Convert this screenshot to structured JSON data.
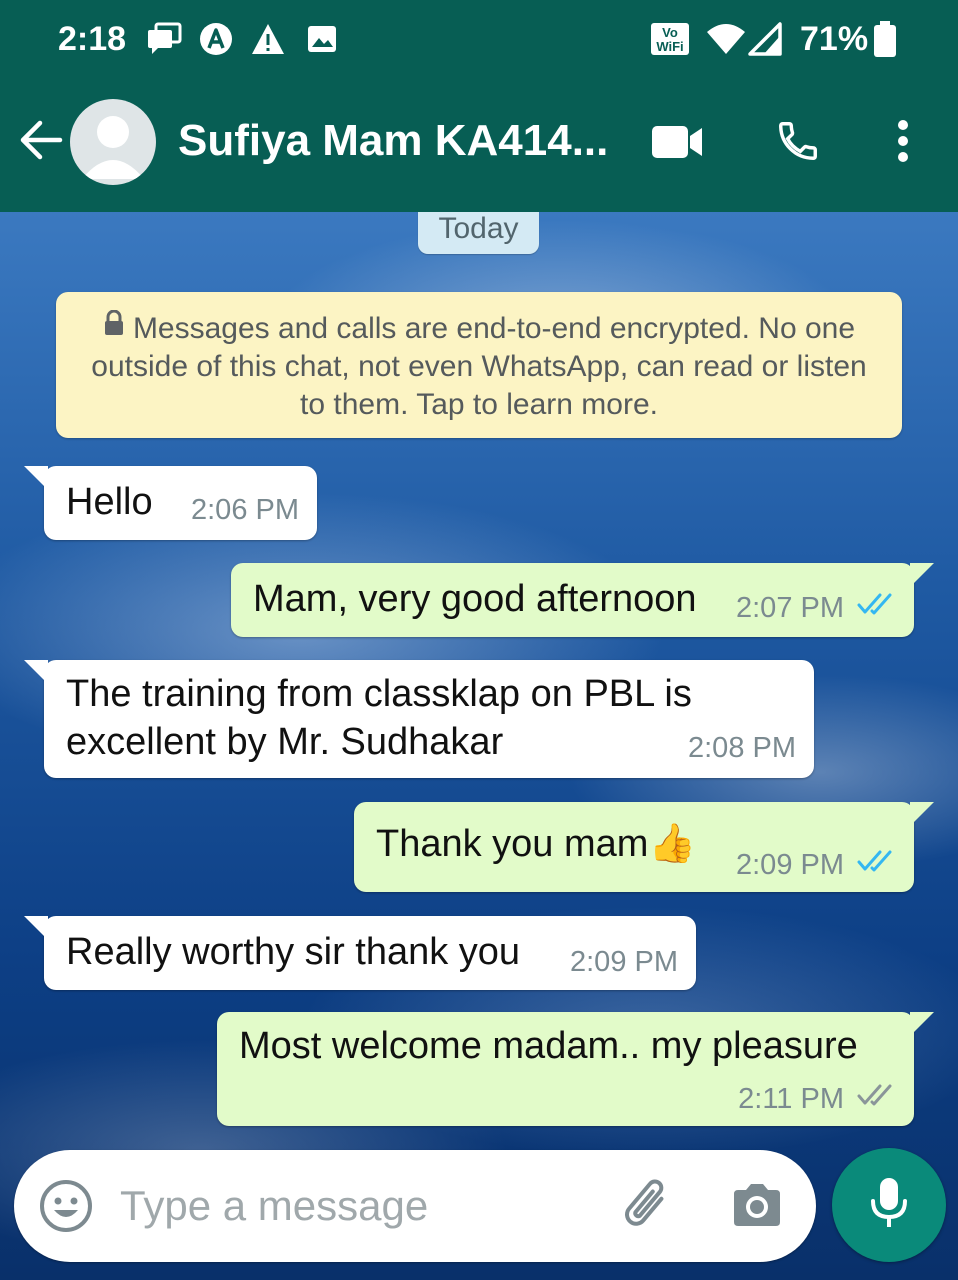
{
  "status_bar": {
    "time": "2:18",
    "battery": "71%",
    "network_badge": "Vo WiFi"
  },
  "header": {
    "contact_name": "Sufiya Mam KA414...",
    "icons": [
      "back-arrow-icon",
      "avatar",
      "video-call-icon",
      "voice-call-icon",
      "more-options-icon"
    ]
  },
  "chat": {
    "date_chip": "Today",
    "encryption_notice": "Messages and calls are end-to-end encrypted. No one outside of this chat, not even WhatsApp, can read or listen to them. Tap to learn more.",
    "messages": [
      {
        "direction": "incoming",
        "text": "Hello",
        "time": "2:06 PM"
      },
      {
        "direction": "outgoing",
        "text": "Mam, very good afternoon",
        "time": "2:07 PM",
        "status": "read"
      },
      {
        "direction": "incoming",
        "text_line1": "The training from classklap on PBL is",
        "text_line2": "excellent by Mr. Sudhakar",
        "time": "2:08 PM"
      },
      {
        "direction": "outgoing",
        "text": "Thank you mam",
        "emoji": "👍",
        "time": "2:09 PM",
        "status": "read"
      },
      {
        "direction": "incoming",
        "text": "Really worthy sir thank you",
        "time": "2:09 PM"
      },
      {
        "direction": "outgoing",
        "text": "Most welcome madam.. my pleasure",
        "time": "2:11 PM",
        "status": "delivered"
      }
    ]
  },
  "composer": {
    "placeholder": "Type a message"
  },
  "colors": {
    "header": "#075e54",
    "outgoing_bubble": "#e2fbc9",
    "incoming_bubble": "#ffffff",
    "notice": "#fcf4c4",
    "read_ticks": "#34b7f1",
    "mic_button": "#0a8a7a"
  }
}
